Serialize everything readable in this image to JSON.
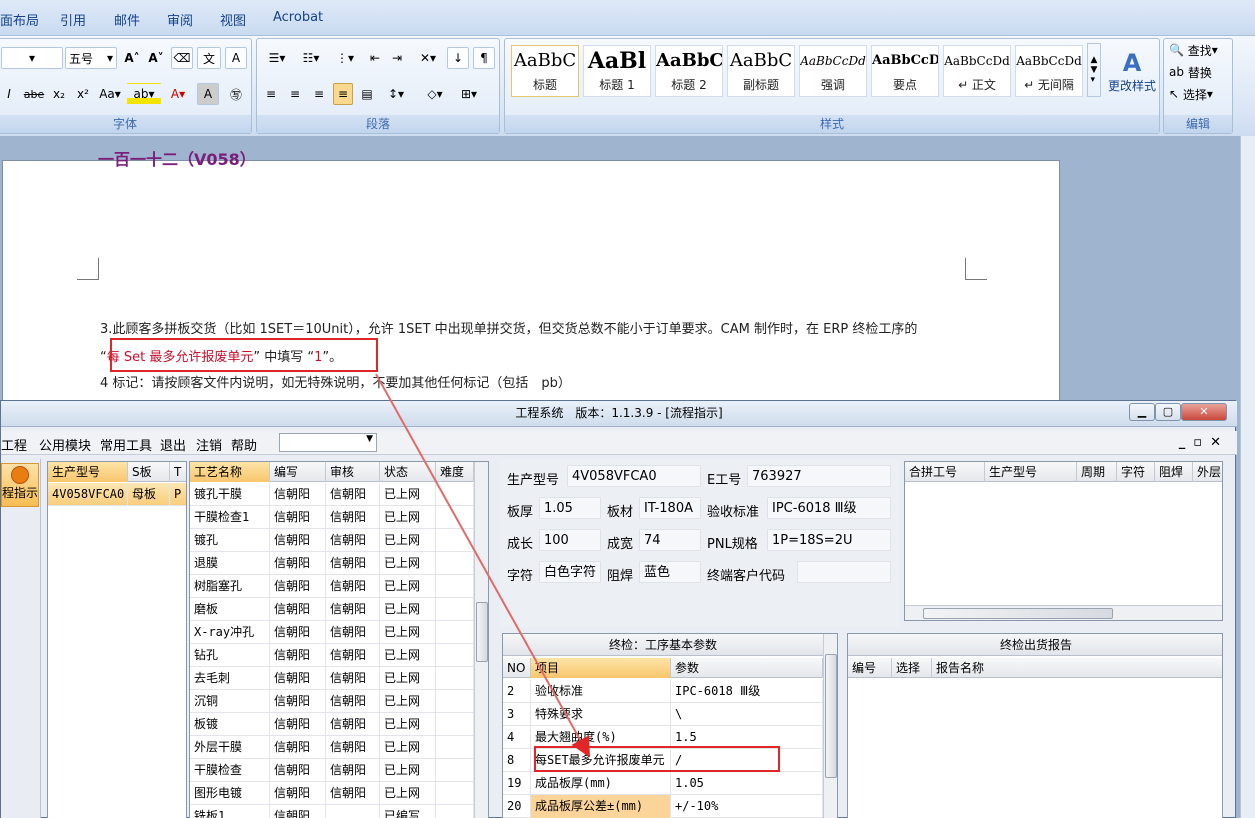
{
  "ribbon": {
    "tabs": [
      "面布局",
      "引用",
      "邮件",
      "审阅",
      "视图",
      "Acrobat"
    ],
    "font_size": "五号",
    "groups": {
      "font": "字体",
      "paragraph": "段落",
      "styles": "样式",
      "edit": "编辑"
    },
    "styles": [
      {
        "sample": "AaBbC",
        "name": "标题"
      },
      {
        "sample": "AaBl",
        "name": "标题 1"
      },
      {
        "sample": "AaBbC",
        "name": "标题 2"
      },
      {
        "sample": "AaBbC",
        "name": "副标题"
      },
      {
        "sample": "AaBbCcDd",
        "name": "强调"
      },
      {
        "sample": "AaBbCcD",
        "name": "要点"
      },
      {
        "sample": "AaBbCcDd",
        "name": "↵ 正文"
      },
      {
        "sample": "AaBbCcDd",
        "name": "↵ 无间隔"
      }
    ],
    "change_styles": "更改样式",
    "find": "查找",
    "replace": "替换",
    "select": "选择"
  },
  "document": {
    "heading": "一百一十二（V058）",
    "line1": "3.此顾客多拼板交货（比如 1SET＝10Unit），允许 1SET 中出现单拼交货，但交货总数不能小于订单要求。CAM 制作时，在 ERP 终检工序的",
    "line2_open": "“",
    "line2_red": "每 Set 最多允许报废单元",
    "line2_mid": "” 中填写 “",
    "line2_val": "1",
    "line2_end": "”。",
    "line3": "4 标记：请按顾客文件内说明，如无特殊说明，不要加其他任何标记（包括　pb）"
  },
  "app": {
    "title": "工程系统　版本：1.1.3.9 - [流程指示]",
    "menu": [
      "工程",
      "公用模块",
      "常用工具",
      "退出",
      "注销",
      "帮助"
    ],
    "flow_button": "程指示",
    "product_grid": {
      "headers": [
        "生产型号",
        "S板",
        "T"
      ],
      "rows": [
        [
          "4V058VFCA0",
          "母板",
          "P"
        ]
      ]
    },
    "process_grid": {
      "headers": [
        "工艺名称",
        "编写",
        "审核",
        "状态",
        "难度"
      ],
      "rows": [
        [
          "镀孔干膜",
          "信朝阳",
          "信朝阳",
          "已上网"
        ],
        [
          "干膜检查1",
          "信朝阳",
          "信朝阳",
          "已上网"
        ],
        [
          "镀孔",
          "信朝阳",
          "信朝阳",
          "已上网"
        ],
        [
          "退膜",
          "信朝阳",
          "信朝阳",
          "已上网"
        ],
        [
          "树脂塞孔",
          "信朝阳",
          "信朝阳",
          "已上网"
        ],
        [
          "磨板",
          "信朝阳",
          "信朝阳",
          "已上网"
        ],
        [
          "X-ray冲孔",
          "信朝阳",
          "信朝阳",
          "已上网"
        ],
        [
          "钻孔",
          "信朝阳",
          "信朝阳",
          "已上网"
        ],
        [
          "去毛刺",
          "信朝阳",
          "信朝阳",
          "已上网"
        ],
        [
          "沉铜",
          "信朝阳",
          "信朝阳",
          "已上网"
        ],
        [
          "板镀",
          "信朝阳",
          "信朝阳",
          "已上网"
        ],
        [
          "外层干膜",
          "信朝阳",
          "信朝阳",
          "已上网"
        ],
        [
          "干膜检查",
          "信朝阳",
          "信朝阳",
          "已上网"
        ],
        [
          "图形电镀",
          "信朝阳",
          "信朝阳",
          "已上网"
        ],
        [
          "铣板1",
          "信朝阳",
          "",
          "已编写"
        ]
      ]
    },
    "info": {
      "model_label": "生产型号",
      "model": "4V058VFCA0",
      "e_label": "E工号",
      "e_no": "763927",
      "thick_label": "板厚",
      "thick": "1.05",
      "material_label": "板材",
      "material": "IT-180A",
      "std_label": "验收标准",
      "std": "IPC-6018 Ⅲ级",
      "len_label": "成长",
      "len": "100",
      "width_label": "成宽",
      "width": "74",
      "pnl_label": "PNL规格",
      "pnl": "1P=18S=2U",
      "char_label": "字符",
      "char": "白色字符",
      "mask_label": "阻焊",
      "mask": "蓝色",
      "cust_label": "终端客户代码",
      "cust": ""
    },
    "merge_grid": {
      "headers": [
        "合拼工号",
        "生产型号",
        "周期",
        "字符",
        "阻焊",
        "外层"
      ]
    },
    "params": {
      "title": "终检：工序基本参数",
      "headers": [
        "NO",
        "项目",
        "参数"
      ],
      "rows": [
        [
          "2",
          "验收标准",
          "IPC-6018 Ⅲ级"
        ],
        [
          "3",
          "特殊要求",
          "\\"
        ],
        [
          "4",
          "最大翘曲度(%)",
          "1.5"
        ],
        [
          "8",
          "每SET最多允许报废单元",
          "/"
        ],
        [
          "19",
          "成品板厚(mm)",
          "1.05"
        ],
        [
          "20",
          "成品板厚公差±(mm)",
          "+/-10%"
        ]
      ]
    },
    "report": {
      "title": "终检出货报告",
      "headers": [
        "编号",
        "选择",
        "报告名称"
      ]
    }
  }
}
